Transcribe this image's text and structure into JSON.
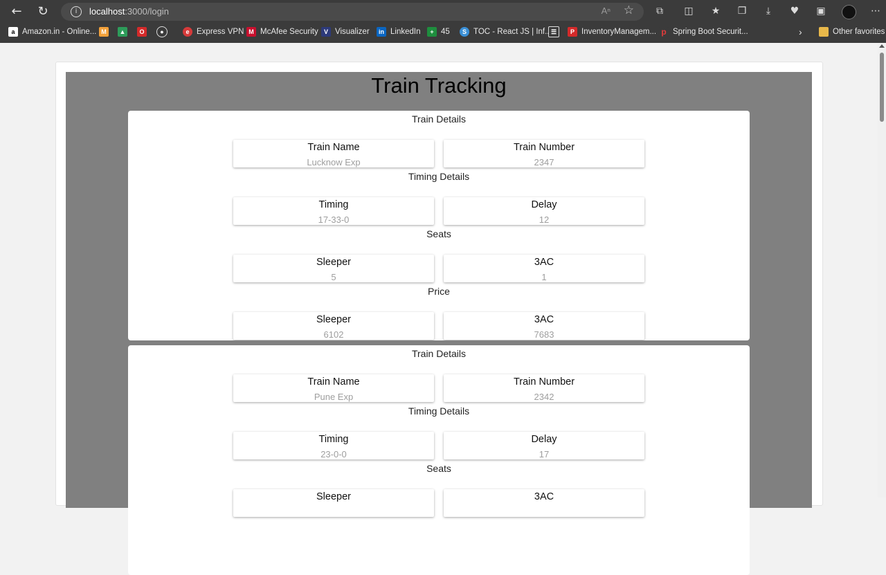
{
  "browser": {
    "url_host": "localhost",
    "url_path": ":3000/login",
    "bookmarks": [
      {
        "label": "Amazon.in - Online..."
      },
      {
        "label": ""
      },
      {
        "label": ""
      },
      {
        "label": ""
      },
      {
        "label": ""
      },
      {
        "label": "Express VPN"
      },
      {
        "label": "McAfee Security"
      },
      {
        "label": "Visualizer"
      },
      {
        "label": "LinkedIn"
      },
      {
        "label": "45"
      },
      {
        "label": "TOC - React JS | Inf..."
      },
      {
        "label": ""
      },
      {
        "label": "InventoryManagem..."
      },
      {
        "label": "Spring Boot Securit..."
      },
      {
        "label": "Other favorites"
      }
    ]
  },
  "page": {
    "title": "Train Tracking",
    "trains": [
      {
        "sections": {
          "train_details": "Train Details",
          "timing_details": "Timing Details",
          "seats": "Seats",
          "price": "Price"
        },
        "train_name_label": "Train Name",
        "train_name": "Lucknow Exp",
        "train_number_label": "Train Number",
        "train_number": "2347",
        "timing_label": "Timing",
        "timing": "17-33-0",
        "delay_label": "Delay",
        "delay": "12",
        "seats_sleeper_label": "Sleeper",
        "seats_sleeper": "5",
        "seats_3ac_label": "3AC",
        "seats_3ac": "1",
        "price_sleeper_label": "Sleeper",
        "price_sleeper": "6102",
        "price_3ac_label": "3AC",
        "price_3ac": "7683"
      },
      {
        "sections": {
          "train_details": "Train Details",
          "timing_details": "Timing Details",
          "seats": "Seats"
        },
        "train_name_label": "Train Name",
        "train_name": "Pune Exp",
        "train_number_label": "Train Number",
        "train_number": "2342",
        "timing_label": "Timing",
        "timing": "23-0-0",
        "delay_label": "Delay",
        "delay": "17",
        "seats_sleeper_label": "Sleeper",
        "seats_3ac_label": "3AC"
      }
    ]
  }
}
